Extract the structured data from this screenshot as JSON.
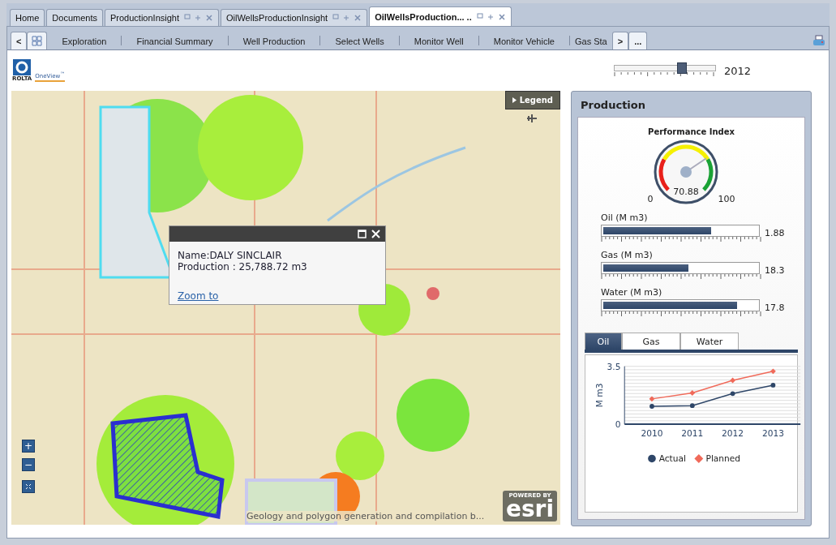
{
  "doc_tabs": [
    {
      "label": "Home",
      "selected": false,
      "controls": false
    },
    {
      "label": "Documents",
      "selected": false,
      "controls": false
    },
    {
      "label": "ProductionInsight",
      "selected": false,
      "controls": true
    },
    {
      "label": "OilWellsProductionInsight",
      "selected": false,
      "controls": true
    },
    {
      "label": "OilWellsProduction... ..",
      "selected": true,
      "controls": true
    }
  ],
  "nav": {
    "back": "<",
    "grid_selected": true,
    "items": [
      "Exploration",
      "Financial Summary",
      "Well Production",
      "Select Wells",
      "Monitor Well",
      "Monitor Vehicle",
      "Gas Sta"
    ],
    "forward": ">",
    "more": "..."
  },
  "logo": {
    "brand": "ROLTA",
    "product": "OneView",
    "mark": "™"
  },
  "year_slider": {
    "level": 0.66,
    "value": "2012"
  },
  "map": {
    "legend": "Legend",
    "zoom_in": "+",
    "zoom_out": "−",
    "attribution": "Geology and polygon generation and compilation b...",
    "powered_by": "POWERED BY",
    "provider": "esri",
    "popup": {
      "name": "Name:DALY SINCLAIR",
      "production": "Production : 25,788.72 m3",
      "link": "Zoom to"
    }
  },
  "panel": {
    "title": "Production",
    "gauge": {
      "title": "Performance Index",
      "value": "70.88",
      "min": "0",
      "max": "100"
    },
    "meters": [
      {
        "label": "Oil (M m3)",
        "level": 0.7,
        "reading": "1.88"
      },
      {
        "label": "Gas (M m3)",
        "level": 0.555,
        "reading": "18.3"
      },
      {
        "label": "Water (M m3)",
        "level": 0.87,
        "reading": "17.8"
      }
    ],
    "chart_tabs": [
      {
        "label": "Oil",
        "selected": true
      },
      {
        "label": "Gas",
        "selected": false
      },
      {
        "label": "Water",
        "selected": false
      }
    ],
    "chart_data": {
      "type": "line",
      "ylabel": "M m3",
      "x": [
        "2010",
        "2011",
        "2012",
        "2013"
      ],
      "ylim": [
        0,
        3.5
      ],
      "yticks": [
        0,
        3.5
      ],
      "legend": true,
      "series": [
        {
          "name": "Actual",
          "color": "#2e4668",
          "marker": "circle",
          "values": [
            1.08,
            1.12,
            1.85,
            2.36
          ]
        },
        {
          "name": "Planned",
          "color": "#f06a5a",
          "marker": "diamond",
          "values": [
            1.53,
            1.89,
            2.65,
            3.2
          ]
        }
      ]
    }
  }
}
